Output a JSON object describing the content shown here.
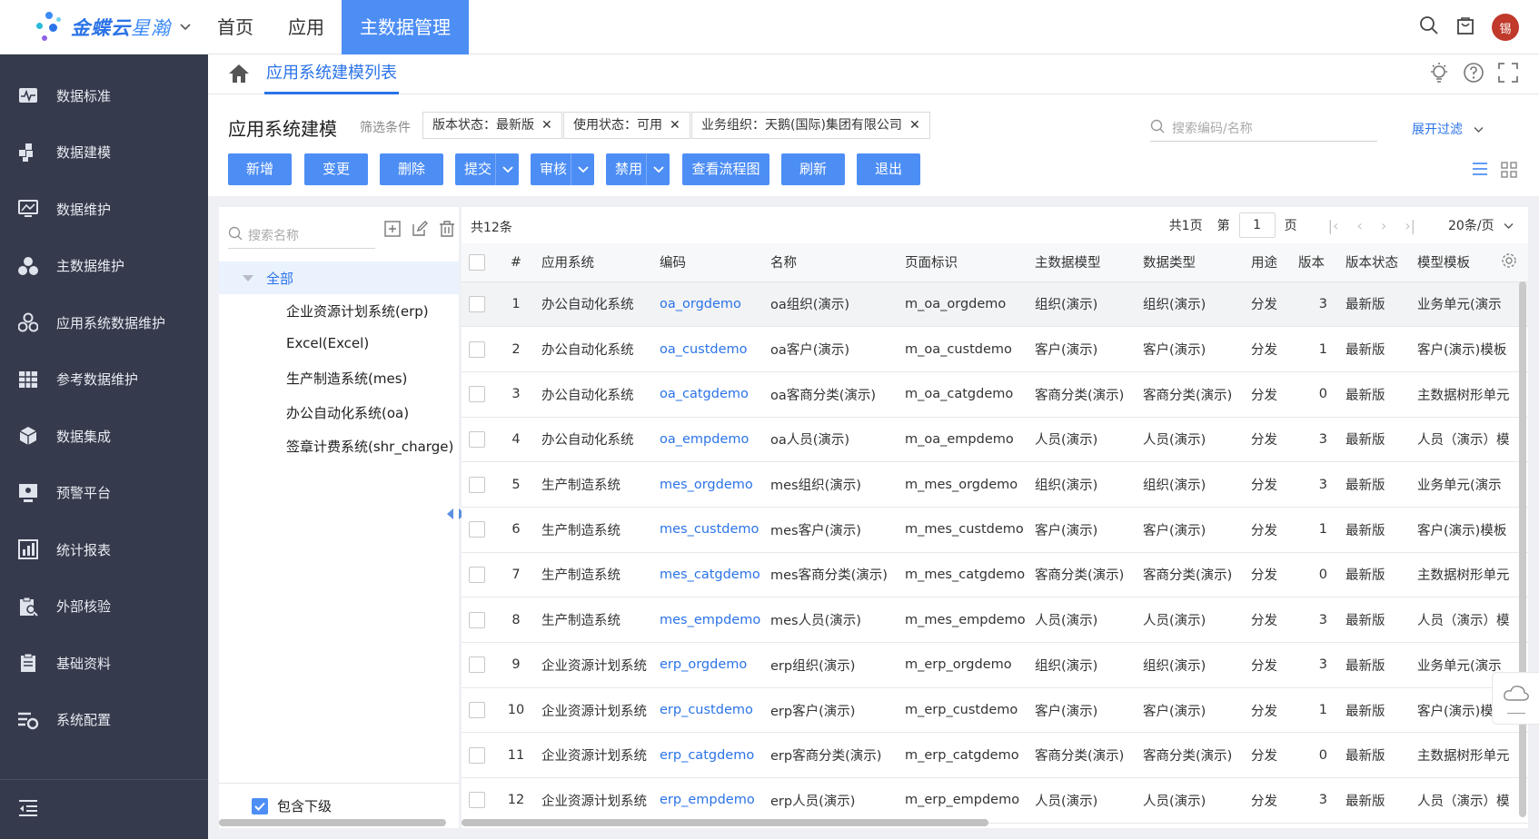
{
  "app": {
    "logo_main": "金蝶云",
    "logo_sub": "星瀚"
  },
  "topnav": [
    {
      "label": "首页"
    },
    {
      "label": "应用"
    },
    {
      "label": "主数据管理"
    }
  ],
  "user": {
    "avatar_text": "锡"
  },
  "sidebar": {
    "items": [
      {
        "label": "数据标准",
        "icon": "pulse-chart-icon"
      },
      {
        "label": "数据建模",
        "icon": "blocks-icon"
      },
      {
        "label": "数据维护",
        "icon": "monitor-icon"
      },
      {
        "label": "主数据维护",
        "icon": "circles-icon"
      },
      {
        "label": "应用系统数据维护",
        "icon": "nodes-icon"
      },
      {
        "label": "参考数据维护",
        "icon": "table-icon"
      },
      {
        "label": "数据集成",
        "icon": "cube-icon"
      },
      {
        "label": "预警平台",
        "icon": "alert-screen-icon"
      },
      {
        "label": "统计报表",
        "icon": "bar-chart-icon"
      },
      {
        "label": "外部核验",
        "icon": "clipboard-search-icon"
      },
      {
        "label": "基础资料",
        "icon": "clipboard-icon"
      },
      {
        "label": "系统配置",
        "icon": "settings-list-icon"
      }
    ]
  },
  "breadcrumb": {
    "tab": "应用系统建模列表"
  },
  "header": {
    "title": "应用系统建模",
    "filter_label": "筛选条件",
    "chips": [
      "版本状态：最新版",
      "使用状态：可用",
      "业务组织：天鹅(国际)集团有限公司"
    ],
    "search_placeholder": "搜索编码/名称",
    "expand_filter": "展开过滤"
  },
  "buttons": [
    {
      "label": "新增"
    },
    {
      "label": "变更"
    },
    {
      "label": "删除"
    },
    {
      "label": "提交"
    },
    {
      "label": "审核"
    },
    {
      "label": "禁用"
    },
    {
      "label": "查看流程图"
    },
    {
      "label": "刷新"
    },
    {
      "label": "退出"
    }
  ],
  "tree": {
    "search_placeholder": "搜索名称",
    "root": "全部",
    "nodes": [
      "企业资源计划系统(erp)",
      "Excel(Excel)",
      "生产制造系统(mes)",
      "办公自动化系统(oa)",
      "签章计费系统(shr_charge)"
    ],
    "include_sub": "包含下级"
  },
  "grid": {
    "total": "共12条",
    "pager": {
      "pages": "共1页",
      "page_prefix": "第",
      "page": "1",
      "page_suffix": "页",
      "size": "20条/页"
    },
    "columns": [
      "#",
      "应用系统",
      "编码",
      "名称",
      "页面标识",
      "主数据模型",
      "数据类型",
      "用途",
      "版本",
      "版本状态",
      "模型模板"
    ],
    "rows": [
      [
        "1",
        "办公自动化系统",
        "oa_orgdemo",
        "oa组织(演示)",
        "m_oa_orgdemo",
        "组织(演示)",
        "组织(演示)",
        "分发",
        "3",
        "最新版",
        "业务单元(演示"
      ],
      [
        "2",
        "办公自动化系统",
        "oa_custdemo",
        "oa客户(演示)",
        "m_oa_custdemo",
        "客户(演示)",
        "客户(演示)",
        "分发",
        "1",
        "最新版",
        "客户(演示)模板"
      ],
      [
        "3",
        "办公自动化系统",
        "oa_catgdemo",
        "oa客商分类(演示)",
        "m_oa_catgdemo",
        "客商分类(演示)",
        "客商分类(演示)",
        "分发",
        "0",
        "最新版",
        "主数据树形单元"
      ],
      [
        "4",
        "办公自动化系统",
        "oa_empdemo",
        "oa人员(演示)",
        "m_oa_empdemo",
        "人员(演示)",
        "人员(演示)",
        "分发",
        "3",
        "最新版",
        "人员（演示）模"
      ],
      [
        "5",
        "生产制造系统",
        "mes_orgdemo",
        "mes组织(演示)",
        "m_mes_orgdemo",
        "组织(演示)",
        "组织(演示)",
        "分发",
        "3",
        "最新版",
        "业务单元(演示"
      ],
      [
        "6",
        "生产制造系统",
        "mes_custdemo",
        "mes客户(演示)",
        "m_mes_custdemo",
        "客户(演示)",
        "客户(演示)",
        "分发",
        "1",
        "最新版",
        "客户(演示)模板"
      ],
      [
        "7",
        "生产制造系统",
        "mes_catgdemo",
        "mes客商分类(演示)",
        "m_mes_catgdemo",
        "客商分类(演示)",
        "客商分类(演示)",
        "分发",
        "0",
        "最新版",
        "主数据树形单元"
      ],
      [
        "8",
        "生产制造系统",
        "mes_empdemo",
        "mes人员(演示)",
        "m_mes_empdemo",
        "人员(演示)",
        "人员(演示)",
        "分发",
        "3",
        "最新版",
        "人员（演示）模"
      ],
      [
        "9",
        "企业资源计划系统",
        "erp_orgdemo",
        "erp组织(演示)",
        "m_erp_orgdemo",
        "组织(演示)",
        "组织(演示)",
        "分发",
        "3",
        "最新版",
        "业务单元(演示"
      ],
      [
        "10",
        "企业资源计划系统",
        "erp_custdemo",
        "erp客户(演示)",
        "m_erp_custdemo",
        "客户(演示)",
        "客户(演示)",
        "分发",
        "1",
        "最新版",
        "客户(演示)模板"
      ],
      [
        "11",
        "企业资源计划系统",
        "erp_catgdemo",
        "erp客商分类(演示)",
        "m_erp_catgdemo",
        "客商分类(演示)",
        "客商分类(演示)",
        "分发",
        "0",
        "最新版",
        "主数据树形单元"
      ],
      [
        "12",
        "企业资源计划系统",
        "erp_empdemo",
        "erp人员(演示)",
        "m_erp_empdemo",
        "人员(演示)",
        "人员(演示)",
        "分发",
        "3",
        "最新版",
        "人员（演示）模"
      ]
    ]
  },
  "colors": {
    "accent": "#4d8ef5",
    "link": "#2b73e8",
    "sidebar": "#353a4c"
  }
}
